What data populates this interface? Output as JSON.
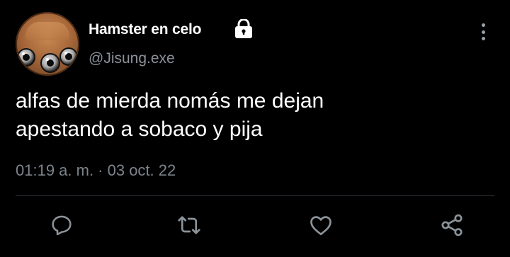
{
  "user": {
    "display_name": "Hamster en celo",
    "handle": "@Jisung.exe",
    "protected_icon": "lock-icon",
    "avatar": "hamster-avatar"
  },
  "tweet": {
    "lines": [
      "alfas de mierda nomás me dejan",
      "apestando a sobaco y pija"
    ],
    "timestamp": "01:19 a. m. · 03 oct. 22"
  },
  "actions": [
    {
      "name": "reply-icon"
    },
    {
      "name": "retweet-icon"
    },
    {
      "name": "like-icon"
    },
    {
      "name": "share-icon"
    }
  ],
  "colors": {
    "background": "#000000",
    "text": "#ffffff",
    "secondary_text": "#7d848c",
    "icon": "#8b9298",
    "divider": "#2a2e33"
  }
}
